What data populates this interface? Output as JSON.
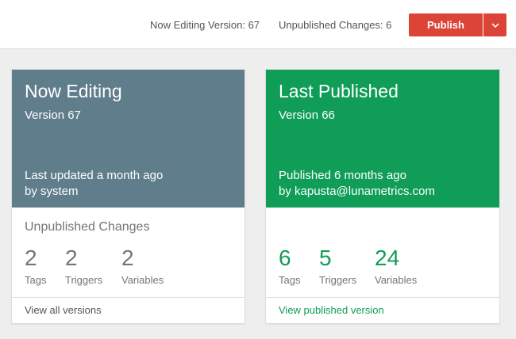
{
  "header": {
    "now_editing": "Now Editing Version: 67",
    "unpublished_changes": "Unpublished Changes: 6",
    "publish_label": "Publish",
    "publish_dropdown_icon": "chevron-down-icon"
  },
  "now_editing_card": {
    "title": "Now Editing",
    "version": "Version 67",
    "updated": "Last updated a month ago",
    "by": "by system",
    "section_label": "Unpublished Changes",
    "stats": [
      {
        "value": "2",
        "label": "Tags"
      },
      {
        "value": "2",
        "label": "Triggers"
      },
      {
        "value": "2",
        "label": "Variables"
      }
    ],
    "footer_link": "View all versions"
  },
  "last_published_card": {
    "title": "Last Published",
    "version": "Version 66",
    "published": "Published 6 months ago",
    "by": "by kapusta@lunametrics.com",
    "stats": [
      {
        "value": "6",
        "label": "Tags"
      },
      {
        "value": "5",
        "label": "Triggers"
      },
      {
        "value": "24",
        "label": "Variables"
      }
    ],
    "footer_link": "View published version"
  },
  "colors": {
    "publish": "#db4437",
    "editing_header": "#607d8b",
    "published_header": "#0f9d58"
  }
}
